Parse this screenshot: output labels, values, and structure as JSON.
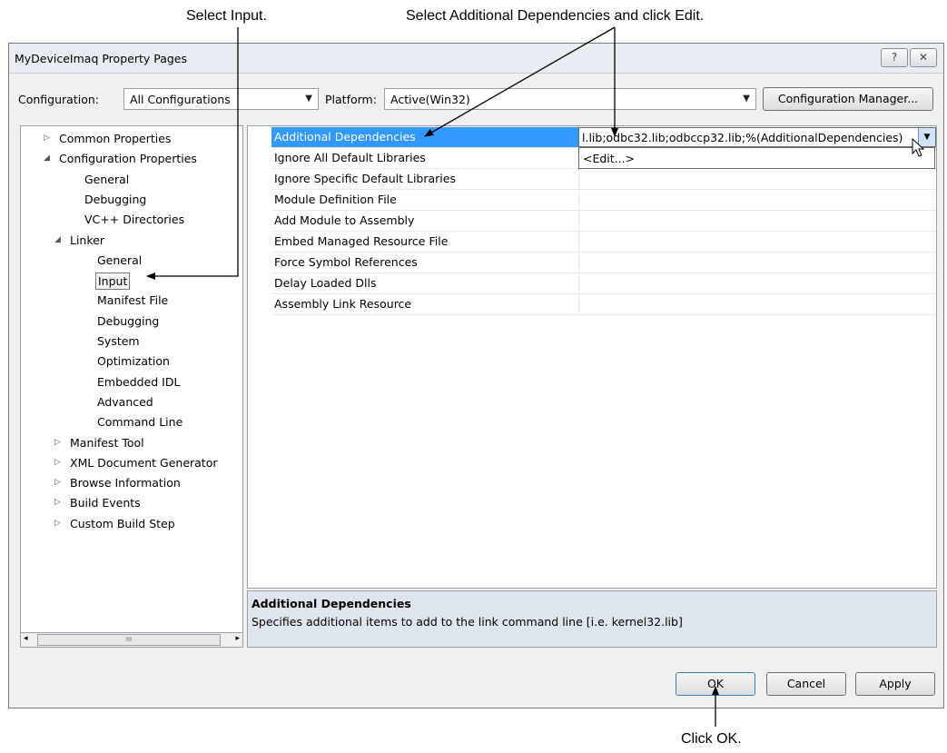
{
  "annotations": {
    "select_input": "Select Input.",
    "select_additional": "Select Additional Dependencies and click Edit.",
    "click_ok": "Click OK."
  },
  "window": {
    "title": "MyDeviceImaq Property Pages",
    "help_icon": "question-mark-icon",
    "close_icon": "close-icon"
  },
  "toolbar": {
    "configuration_label": "Configuration:",
    "configuration_value": "All Configurations",
    "platform_label": "Platform:",
    "platform_value": "Active(Win32)",
    "config_manager_label": "Configuration Manager..."
  },
  "tree": {
    "items": [
      {
        "label": "Common Properties",
        "toggle": "▷"
      },
      {
        "label": "Configuration Properties",
        "toggle": "◢"
      },
      {
        "label": "General"
      },
      {
        "label": "Debugging"
      },
      {
        "label": "VC++ Directories"
      },
      {
        "label": "Linker",
        "toggle": "◢"
      },
      {
        "label": "General"
      },
      {
        "label": "Input"
      },
      {
        "label": "Manifest File"
      },
      {
        "label": "Debugging"
      },
      {
        "label": "System"
      },
      {
        "label": "Optimization"
      },
      {
        "label": "Embedded IDL"
      },
      {
        "label": "Advanced"
      },
      {
        "label": "Command Line"
      },
      {
        "label": "Manifest Tool",
        "toggle": "▷"
      },
      {
        "label": "XML Document Generator",
        "toggle": "▷"
      },
      {
        "label": "Browse Information",
        "toggle": "▷"
      },
      {
        "label": "Build Events",
        "toggle": "▷"
      },
      {
        "label": "Custom Build Step",
        "toggle": "▷"
      }
    ],
    "scroll_thumb": "III"
  },
  "grid": {
    "rows": [
      {
        "name": "Additional Dependencies",
        "value": "l.lib;odbc32.lib;odbccp32.lib;%(AdditionalDependencies)"
      },
      {
        "name": "Ignore All Default Libraries",
        "value": ""
      },
      {
        "name": "Ignore Specific Default Libraries",
        "value": ""
      },
      {
        "name": "Module Definition File",
        "value": ""
      },
      {
        "name": "Add Module to Assembly",
        "value": ""
      },
      {
        "name": "Embed Managed Resource File",
        "value": ""
      },
      {
        "name": "Force Symbol References",
        "value": ""
      },
      {
        "name": "Delay Loaded Dlls",
        "value": ""
      },
      {
        "name": "Assembly Link Resource",
        "value": ""
      }
    ],
    "dropdown_option": "<Edit...>"
  },
  "description": {
    "title": "Additional Dependencies",
    "text": "Specifies additional items to add to the link command line [i.e. kernel32.lib]"
  },
  "buttons": {
    "ok": "OK",
    "cancel": "Cancel",
    "apply": "Apply"
  },
  "colors": {
    "selection": "#3399ff",
    "dialog_bg": "#f0f0f0",
    "description_bg": "#dfe5ec"
  }
}
